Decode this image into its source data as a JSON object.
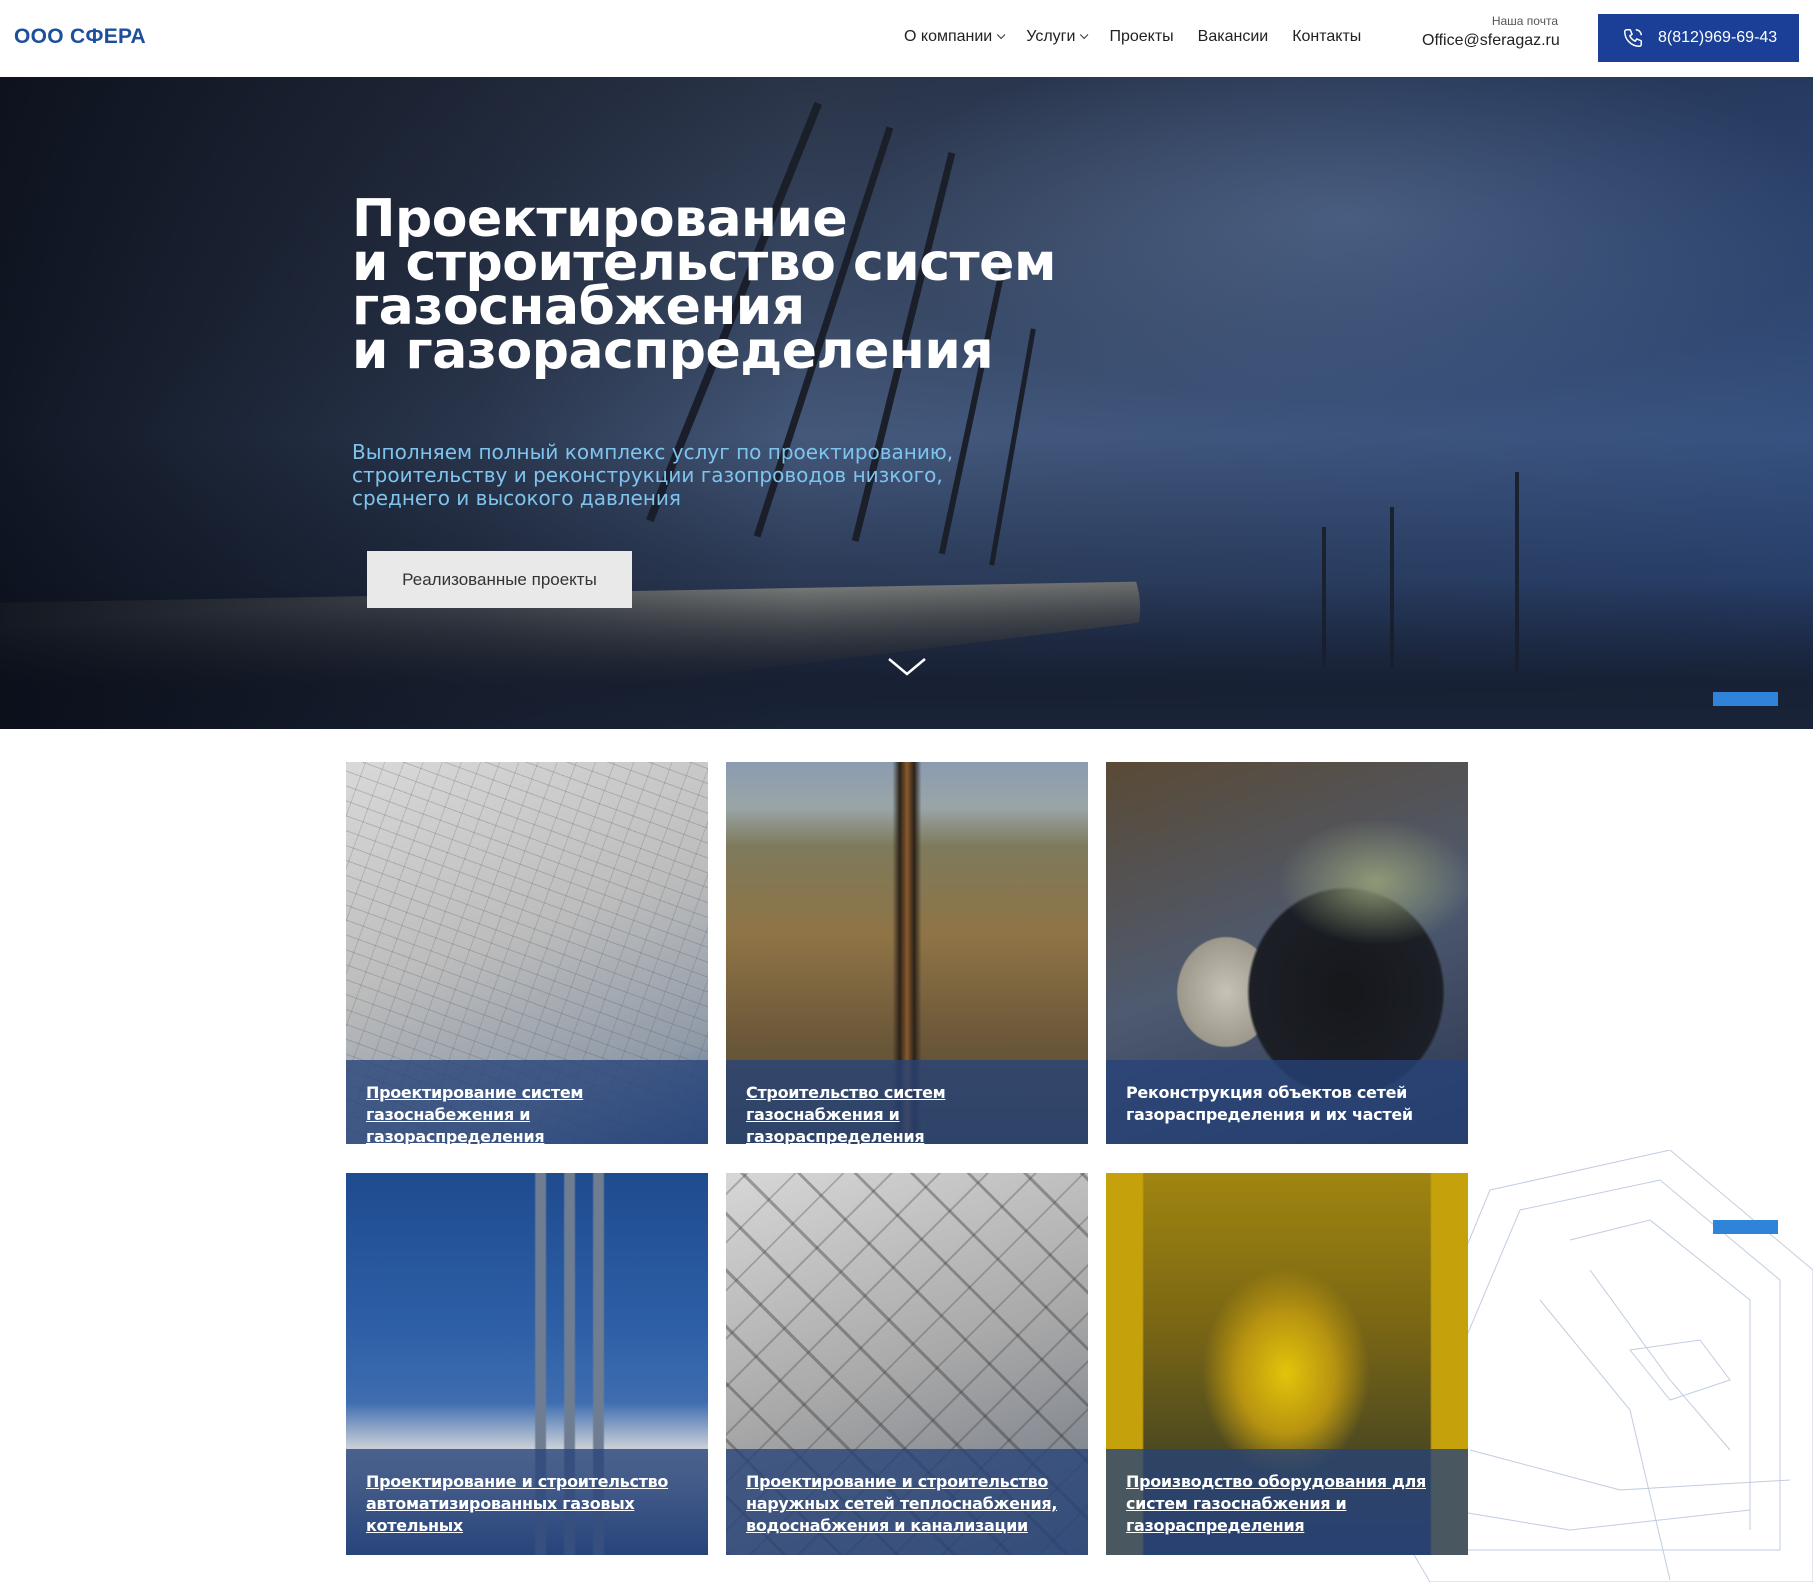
{
  "header": {
    "logo": "ООО СФЕРА",
    "nav": [
      {
        "label": "О компании",
        "dropdown": true
      },
      {
        "label": "Услуги",
        "dropdown": true
      },
      {
        "label": "Проекты",
        "dropdown": false
      },
      {
        "label": "Вакансии",
        "dropdown": false
      },
      {
        "label": "Контакты",
        "dropdown": false
      }
    ],
    "mail_label": "Наша почта",
    "mail_value": "Office@sferagaz.ru",
    "phone": "8(812)969-69-43",
    "phone_icon": "phone-icon",
    "accent_color": "#1b3f97"
  },
  "hero": {
    "title_lines": [
      "Проектирование",
      "и строительство систем",
      "газоснабжения",
      "и газораспределения"
    ],
    "subtitle_lines": [
      "Выполняем полный комплекс услуг по проектированию,",
      "строительству и реконструкции газопроводов низкого,",
      "среднего и высокого давления"
    ],
    "button": "Реализованные проекты",
    "subtitle_color": "#7fc4ee",
    "scroll_icon": "chevron-down-icon"
  },
  "services": [
    {
      "lines": [
        "Проектирование систем",
        "газоснабежения и газораспределения"
      ]
    },
    {
      "lines": [
        "Строительство систем газоснабжения и",
        "газораспределения"
      ]
    },
    {
      "lines": [
        "Реконструкция объектов сетей",
        "газораспределения и их частей"
      ]
    },
    {
      "lines": [
        "Проектирование и строительство",
        "автоматизированных газовых",
        "котельных"
      ]
    },
    {
      "lines": [
        "Проектирование и строительство",
        "наружных сетей теплоснабжения,",
        "водоснабжения и канализации"
      ]
    },
    {
      "lines": [
        "Производство оборудования для",
        "систем газоснабжения и",
        "газораспределения"
      ]
    }
  ]
}
